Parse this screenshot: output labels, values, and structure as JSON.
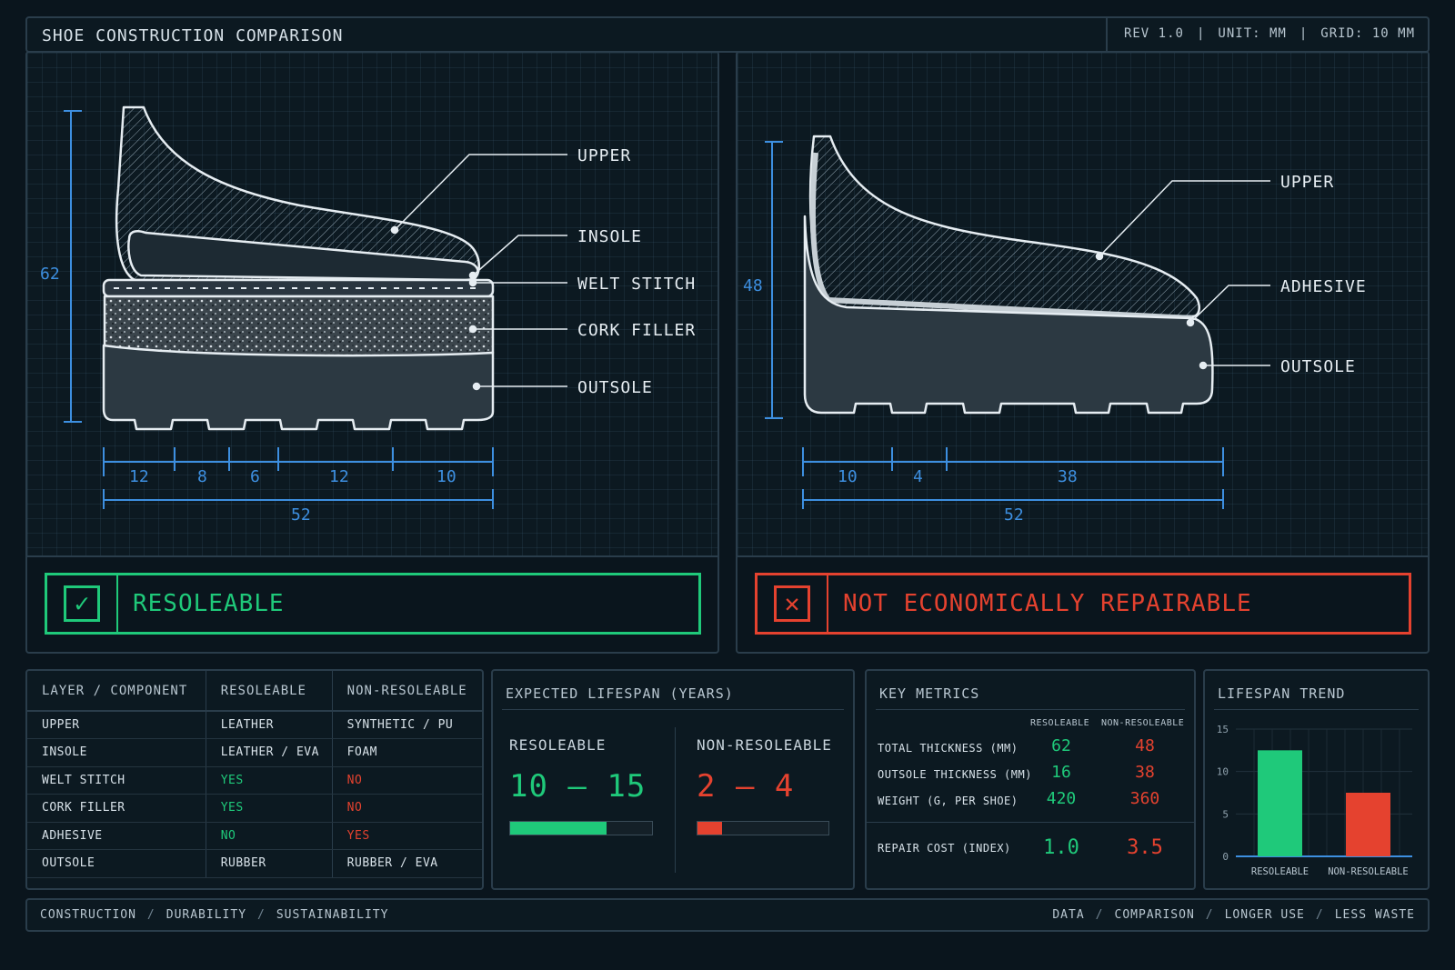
{
  "header": {
    "title": "SHOE CONSTRUCTION COMPARISON",
    "rev": "REV 1.0",
    "unit": "UNIT: MM",
    "grid": "GRID: 10 MM"
  },
  "left_diagram": {
    "callouts": [
      "UPPER",
      "INSOLE",
      "WELT STITCH",
      "CORK FILLER",
      "OUTSOLE"
    ],
    "height_dim": "62",
    "segment_dims": [
      "12",
      "8",
      "6",
      "12",
      "10"
    ],
    "total_dim": "52",
    "verdict": "RESOLEABLE",
    "verdict_icon": "check-icon"
  },
  "right_diagram": {
    "callouts": [
      "UPPER",
      "ADHESIVE",
      "OUTSOLE"
    ],
    "height_dim": "48",
    "segment_dims": [
      "10",
      "4",
      "38"
    ],
    "total_dim": "52",
    "verdict": "NOT ECONOMICALLY REPAIRABLE",
    "verdict_icon": "cross-icon"
  },
  "layers_table": {
    "headers": [
      "LAYER / COMPONENT",
      "RESOLEABLE",
      "NON-RESOLEABLE"
    ],
    "rows": [
      [
        "UPPER",
        "LEATHER",
        "SYNTHETIC / PU"
      ],
      [
        "INSOLE",
        "LEATHER / EVA",
        "FOAM"
      ],
      [
        "WELT STITCH",
        "YES",
        "NO"
      ],
      [
        "CORK FILLER",
        "YES",
        "NO"
      ],
      [
        "ADHESIVE",
        "NO",
        "YES"
      ],
      [
        "OUTSOLE",
        "RUBBER",
        "RUBBER / EVA"
      ]
    ]
  },
  "lifespan": {
    "title": "EXPECTED LIFESPAN (YEARS)",
    "resoleable": {
      "label": "RESOLEABLE",
      "value": "10 – 15",
      "fill": 0.68
    },
    "non_resoleable": {
      "label": "NON-RESOLEABLE",
      "value": "2 – 4",
      "fill": 0.19
    }
  },
  "metrics": {
    "title": "KEY METRICS",
    "col_resoleable": "RESOLEABLE",
    "col_non_resoleable": "NON-RESOLEABLE",
    "rows": [
      {
        "label": "TOTAL THICKNESS (MM)",
        "resoleable": "62",
        "non_resoleable": "48"
      },
      {
        "label": "OUTSOLE THICKNESS (MM)",
        "resoleable": "16",
        "non_resoleable": "38"
      },
      {
        "label": "WEIGHT (G, PER SHOE)",
        "resoleable": "420",
        "non_resoleable": "360"
      },
      {
        "label": "REPAIR COST (INDEX)",
        "resoleable": "1.0",
        "non_resoleable": "3.5"
      }
    ]
  },
  "trend": {
    "title": "LIFESPAN TREND",
    "chart_data": {
      "type": "bar",
      "categories": [
        "RESOLEABLE",
        "NON-RESOLEABLE"
      ],
      "values": [
        12.5,
        7.5
      ],
      "yticks": [
        "0",
        "5",
        "10",
        "15"
      ],
      "ylim": [
        0,
        15
      ],
      "colors": [
        "#1fc97a",
        "#e5422f"
      ]
    }
  },
  "footer": {
    "left": [
      "CONSTRUCTION",
      "DURABILITY",
      "SUSTAINABILITY"
    ],
    "right": [
      "DATA",
      "COMPARISON",
      "LONGER USE",
      "LESS WASTE"
    ]
  },
  "colors": {
    "accent_blue": "#3d8fe0",
    "good": "#1fc97a",
    "bad": "#e5422f"
  }
}
